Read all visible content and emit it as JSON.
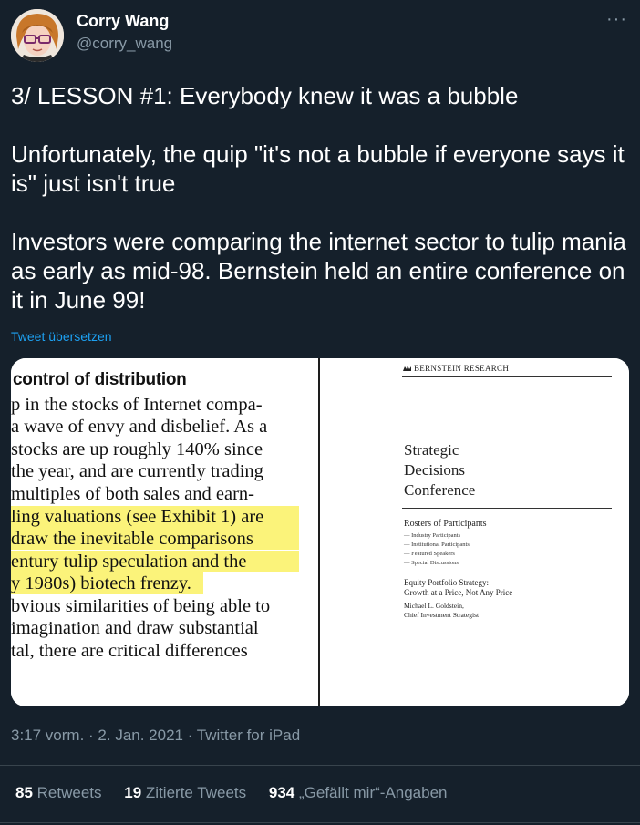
{
  "author": {
    "name": "Corry Wang",
    "handle": "@corry_wang"
  },
  "more_label": "···",
  "tweet": {
    "line1": "3/ LESSON #1: Everybody knew it was a bubble",
    "line2": "Unfortunately, the quip \"it's not a bubble if everyone says it is\" just isn't true",
    "line3": "Investors were comparing the internet sector to tulip mania as early as mid-98. Bernstein held an entire conference on it in June 99!"
  },
  "translate_label": "Tweet übersetzen",
  "media": {
    "left": {
      "heading": "control of distribution",
      "lines": [
        "p in the stocks of Internet compa-",
        "a wave of envy and disbelief. As a",
        "stocks are up roughly 140% since",
        "the year, and are currently trading",
        "multiples of both sales and earn-",
        "ling valuations (see Exhibit 1) are",
        " draw the inevitable comparisons",
        "entury tulip speculation and the",
        "y 1980s) biotech frenzy.",
        "bvious similarities of being able to",
        "imagination and draw substantial",
        "tal, there are critical differences"
      ]
    },
    "right": {
      "brand": "BERNSTEIN RESEARCH",
      "title_lines": [
        "Strategic",
        "Decisions",
        "Conference"
      ],
      "roster_heading": "Rosters of Participants",
      "roster_items": [
        "— Industry Participants",
        "— Institutional Participants",
        "— Featured Speakers",
        "— Special Discussions"
      ],
      "strategy_line1": "Equity Portfolio Strategy:",
      "strategy_line2": "Growth at a Price, Not Any Price",
      "author_line1": "Michael L. Goldstein,",
      "author_line2": "Chief Investment Strategist"
    }
  },
  "meta": "3:17 vorm. · 2. Jan. 2021 · Twitter for iPad",
  "stats": {
    "retweets_count": "85",
    "retweets_label": "Retweets",
    "quotes_count": "19",
    "quotes_label": "Zitierte Tweets",
    "likes_count": "934",
    "likes_label": "„Gefällt mir“-Angaben"
  }
}
